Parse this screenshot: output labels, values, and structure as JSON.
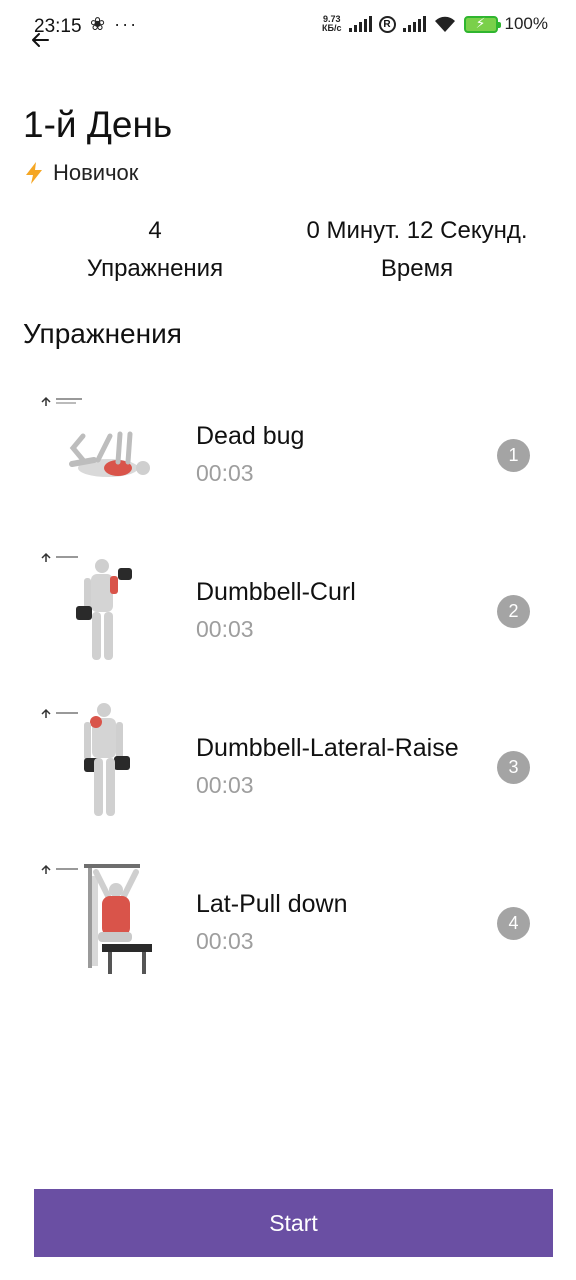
{
  "status_bar": {
    "time": "23:15",
    "left_icons": "❀ ···",
    "speed_top": "9.73",
    "speed_bottom": "КБ/с",
    "r_label": "R",
    "battery_text": "100%"
  },
  "header": {
    "title": "1-й День",
    "level": "Новичок"
  },
  "stats": {
    "count_value": "4",
    "count_label": "Упражнения",
    "time_value": "0 Минут. 12 Секунд.",
    "time_label": "Время"
  },
  "section_title": "Упражнения",
  "exercises": [
    {
      "name": "Dead bug",
      "duration": "00:03",
      "index": "1"
    },
    {
      "name": "Dumbbell-Curl",
      "duration": "00:03",
      "index": "2"
    },
    {
      "name": "Dumbbell-Lateral-Raise",
      "duration": "00:03",
      "index": "3"
    },
    {
      "name": "Lat-Pull down",
      "duration": "00:03",
      "index": "4"
    }
  ],
  "start_label": "Start",
  "colors": {
    "accent": "#6a4fa3",
    "badge": "#a4a4a4",
    "muted_text": "#9e9e9e",
    "muscle_highlight": "#d9544a"
  },
  "icons": {
    "back": "arrow-left-icon",
    "level": "lightning-bolt-icon"
  }
}
